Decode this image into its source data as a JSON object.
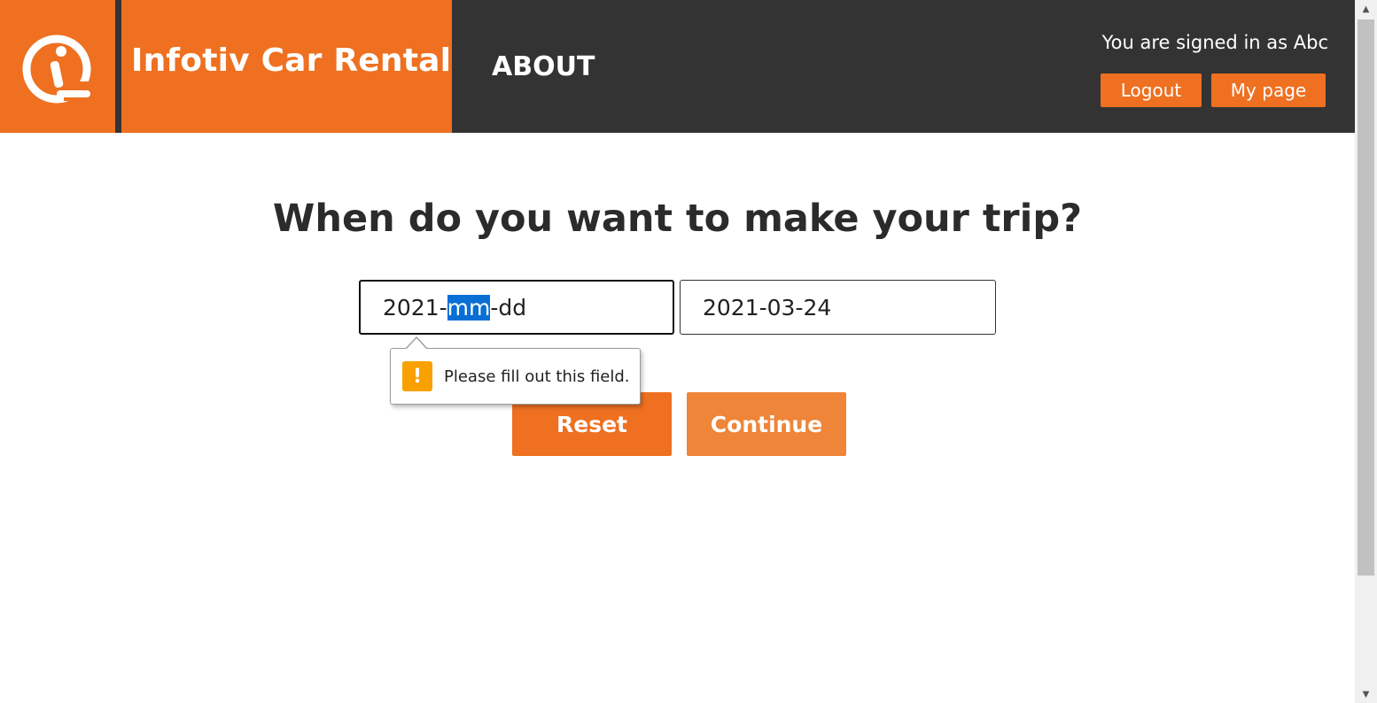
{
  "header": {
    "brand_title": "Infotiv Car Rental",
    "logo_icon": "infotiv-logo-icon",
    "nav_about": "ABOUT",
    "signed_in_text": "You are signed in as Abc",
    "logout_label": "Logout",
    "mypage_label": "My page"
  },
  "main": {
    "heading": "When do you want to make your trip?",
    "start_date": {
      "year": "2021",
      "sep1": "-",
      "month": "mm",
      "sep2": "-",
      "day": "dd"
    },
    "end_date": {
      "value": "2021-03-24"
    },
    "reset_label": "Reset",
    "continue_label": "Continue"
  },
  "tooltip": {
    "icon": "warning-icon",
    "icon_glyph": "!",
    "text": "Please fill out this field."
  },
  "scrollbar": {
    "up_glyph": "▲",
    "down_glyph": "▼"
  },
  "colors": {
    "brand_orange": "#ee7020",
    "header_dark": "#333333",
    "continue_orange": "#ef8538",
    "warning_yellow": "#f8a100",
    "selection_blue": "#0a6fd4"
  }
}
